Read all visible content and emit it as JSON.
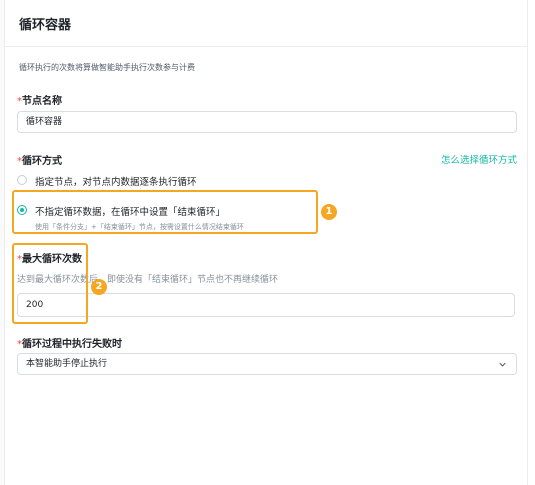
{
  "header": {
    "title": "循环容器"
  },
  "description": "循环执行的次数将算做智能助手执行次数参与计费",
  "node_name": {
    "required": "*",
    "label": "节点名称",
    "value": "循环容器"
  },
  "loop_mode": {
    "required": "*",
    "label": "循环方式",
    "help_link": "怎么选择循环方式",
    "options": [
      {
        "label": "指定节点，对节点内数据逐条执行循环",
        "selected": false
      },
      {
        "label": "不指定循环数据，在循环中设置「结束循环」",
        "sub": "使用「条件分支」+「结束循环」节点，按需设置什么情况结束循环",
        "selected": true
      }
    ]
  },
  "max_loops": {
    "required": "*",
    "label": "最大循环次数",
    "hint": "达到最大循环次数后，即使没有「结束循环」节点也不再继续循环",
    "value": "200"
  },
  "on_failure": {
    "required": "*",
    "label": "循环过程中执行失败时",
    "value": "本智能助手停止执行"
  },
  "annotations": {
    "badge1": "1",
    "badge2": "2",
    "color": "#f5a623"
  },
  "colors": {
    "accent": "#15b8a6",
    "required": "#f53f3f"
  },
  "icons": {
    "select": "chevron-down-icon"
  }
}
